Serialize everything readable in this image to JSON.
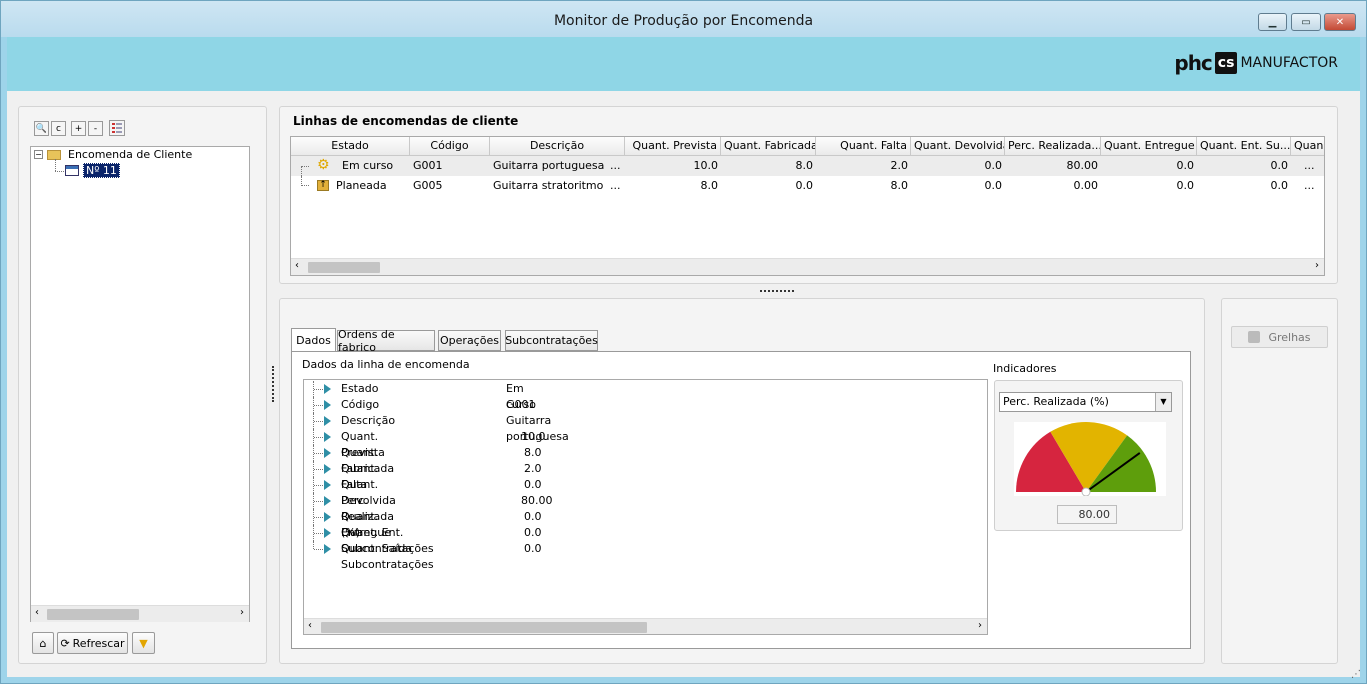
{
  "window": {
    "title": "Monitor de Produção por Encomenda",
    "min": "▁",
    "max": "▭",
    "close": "✕"
  },
  "brand": {
    "phc": "phc",
    "cs": "cs",
    "manufactor": "MANUFACTOR"
  },
  "tree": {
    "toolbar": {
      "search": "🔍",
      "c": "c",
      "plus": "+",
      "minus": "-"
    },
    "root_label": "Encomenda de Cliente",
    "child_label": "Nº 11"
  },
  "left_bottom": {
    "home": "⌂",
    "refresh": "Refrescar",
    "filter": "▼"
  },
  "lines": {
    "title": "Linhas de encomendas de cliente",
    "columns": [
      "Estado",
      "Código",
      "Descrição",
      "Quant. Prevista",
      "Quant. Fabricada",
      "Quant. Falta",
      "Quant. Devolvida",
      "Perc. Realizada...",
      "Quant. Entregue",
      "Quant. Ent. Su...",
      "Quan"
    ],
    "rows": [
      {
        "estado": "Em curso",
        "codigo": "G001",
        "descricao": "Guitarra portuguesa",
        "ellipsis": "...",
        "prevista": "10.0",
        "fabricada": "8.0",
        "falta": "2.0",
        "devolvida": "0.0",
        "perc": "80.00",
        "entregue": "0.0",
        "entsub": "0.0",
        "more": "..."
      },
      {
        "estado": "Planeada",
        "codigo": "G005",
        "descricao": "Guitarra stratoritmo",
        "ellipsis": "...",
        "prevista": "8.0",
        "fabricada": "0.0",
        "falta": "8.0",
        "devolvida": "0.0",
        "perc": "0.00",
        "entregue": "0.0",
        "entsub": "0.0",
        "more": "..."
      }
    ]
  },
  "tabs": [
    "Dados",
    "Ordens de fabrico",
    "Operações",
    "Subcontratações"
  ],
  "details": {
    "title": "Dados da linha de encomenda",
    "rows": [
      {
        "label": "Estado",
        "value": "Em curso"
      },
      {
        "label": "Código",
        "value": "G001"
      },
      {
        "label": "Descrição",
        "value": "Guitarra portuguesa"
      },
      {
        "label": "Quant. Prevista",
        "value": "10.0"
      },
      {
        "label": "Quant. Fabricada",
        "value": "8.0"
      },
      {
        "label": "Quant. Falta",
        "value": "2.0"
      },
      {
        "label": "Quant. Devolvida",
        "value": "0.0"
      },
      {
        "label": "Perc. Realizada (%)",
        "value": "80.00"
      },
      {
        "label": "Quant. Entregue",
        "value": "0.0"
      },
      {
        "label": "Quant. Ent. Subcontratações",
        "value": "0.0"
      },
      {
        "label": "Quant. Saída Subcontratações",
        "value": "0.0"
      }
    ]
  },
  "indicators": {
    "title": "Indicadores",
    "selected": "Perc. Realizada (%)",
    "value": "80.00",
    "gauge_fraction": 0.8,
    "colors": {
      "red": "#d6253f",
      "yellow": "#e2b400",
      "green": "#5e9e0c"
    }
  },
  "right_panel": {
    "grelhas": "Grelhas"
  }
}
